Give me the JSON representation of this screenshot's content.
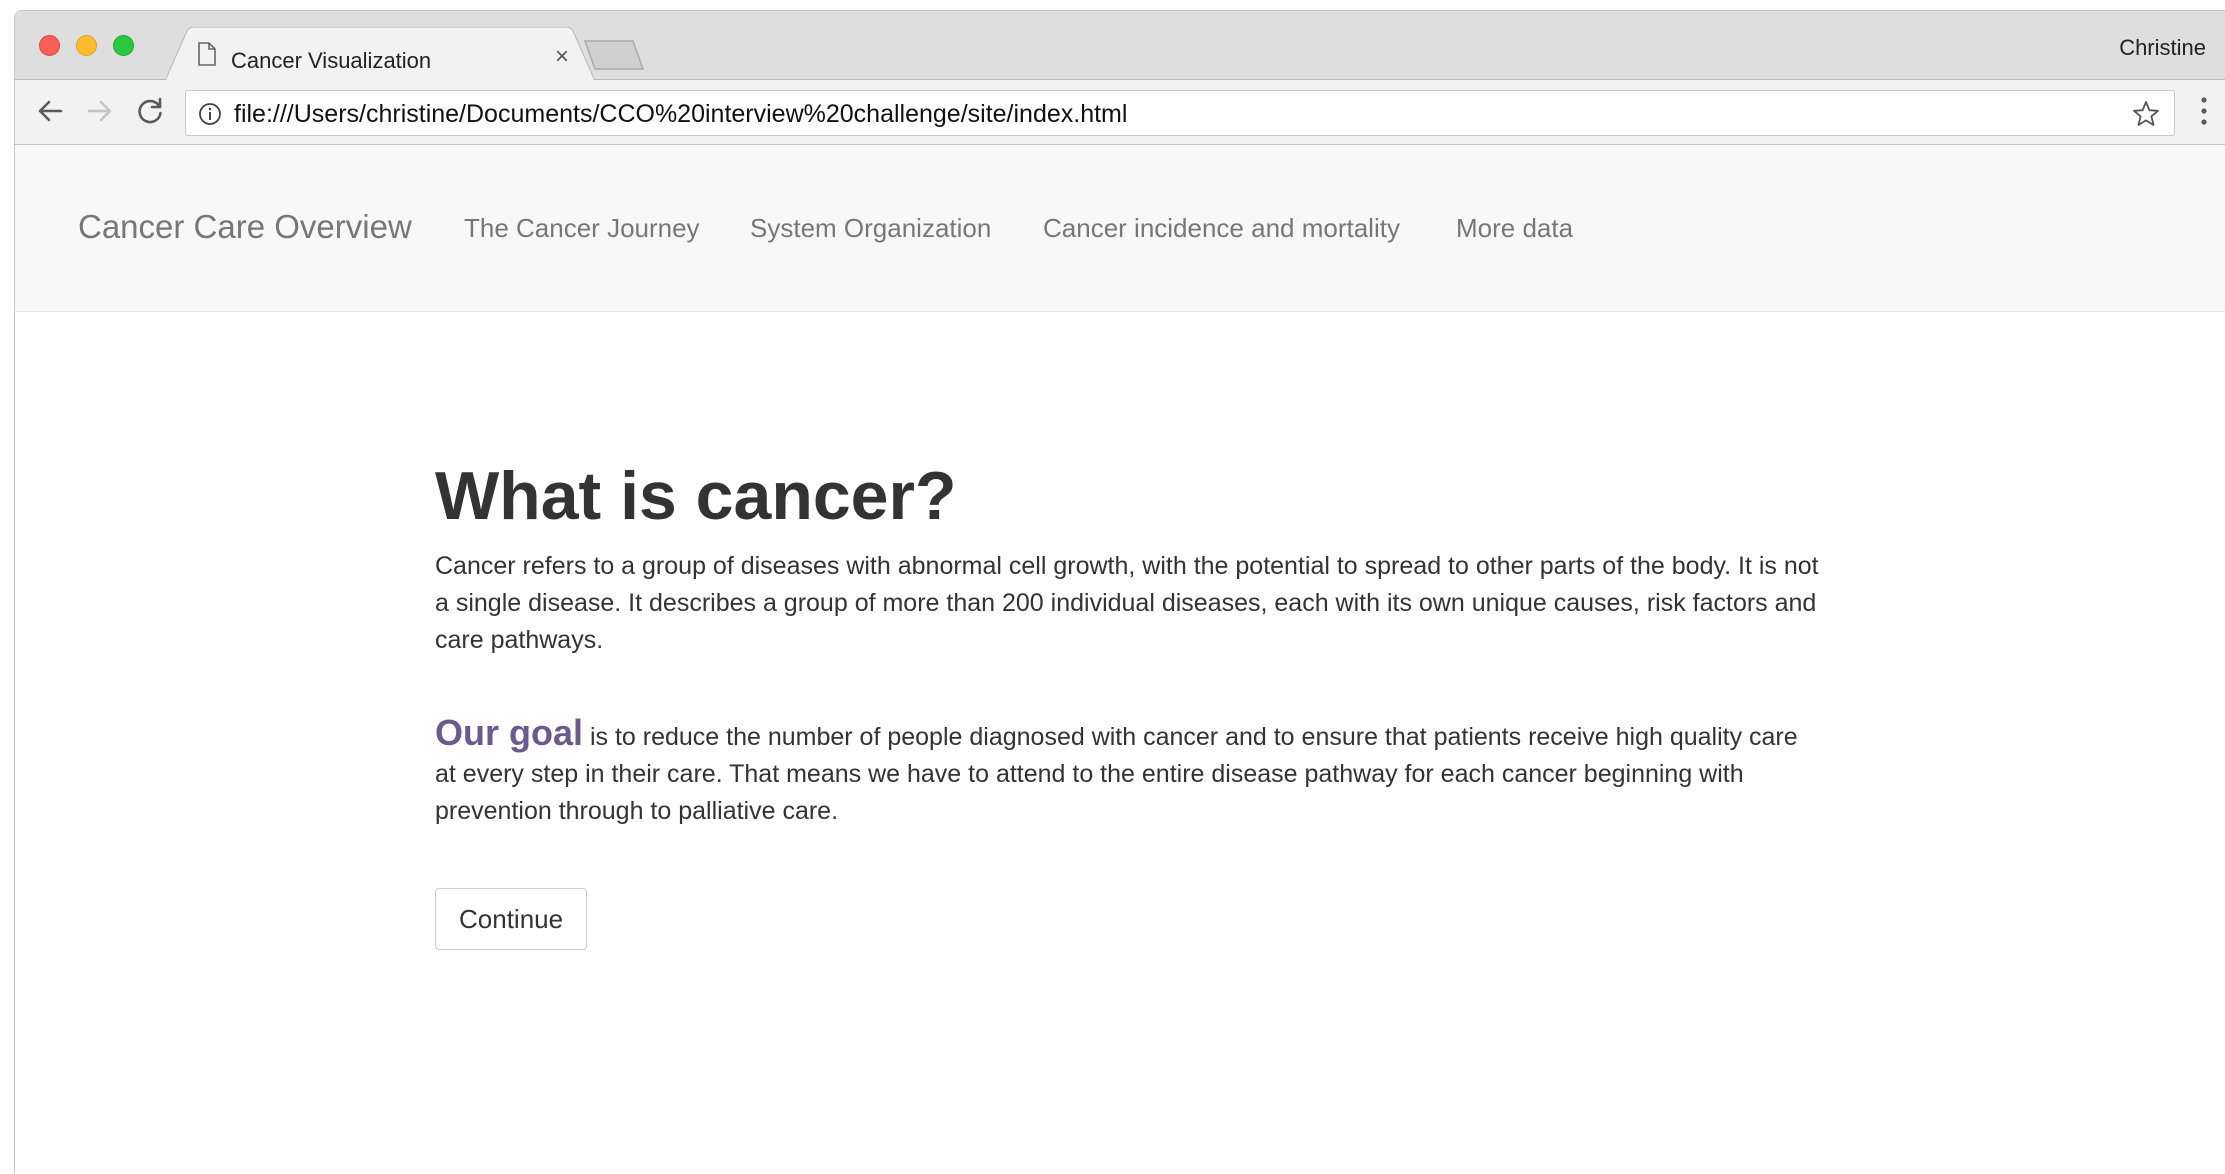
{
  "browser": {
    "tab_title": "Cancer Visualization",
    "tab_close": "×",
    "profile_name": "Christine",
    "url": "file:///Users/christine/Documents/CCO%20interview%20challenge/site/index.html",
    "icons": {
      "back": "back-arrow-icon",
      "forward": "forward-arrow-icon",
      "reload": "reload-icon",
      "info": "info-icon",
      "star": "star-icon",
      "menu": "vertical-dots-menu-icon",
      "page": "page-icon"
    }
  },
  "navbar": {
    "brand": "Cancer Care Overview",
    "links": [
      "The Cancer Journey",
      "System Organization",
      "Cancer incidence and mortality",
      "More data"
    ]
  },
  "main": {
    "heading": "What is cancer?",
    "intro": "Cancer refers to a group of diseases with abnormal cell growth, with the potential to spread to other parts of the body. It is not a single disease. It describes a group of more than 200 individual diseases, each with its own unique causes, risk factors and care pathways.",
    "goal_lead": "Our goal",
    "goal_text": " is to reduce the number of people diagnosed with cancer and to ensure that patients receive high quality care at every step in their care. That means we have to attend to the entire disease pathway for each cancer beginning with prevention through to palliative care.",
    "continue_label": "Continue"
  },
  "colors": {
    "accent_purple": "#6a5a8e",
    "navbar_bg": "#f8f8f8",
    "text": "#333333"
  }
}
